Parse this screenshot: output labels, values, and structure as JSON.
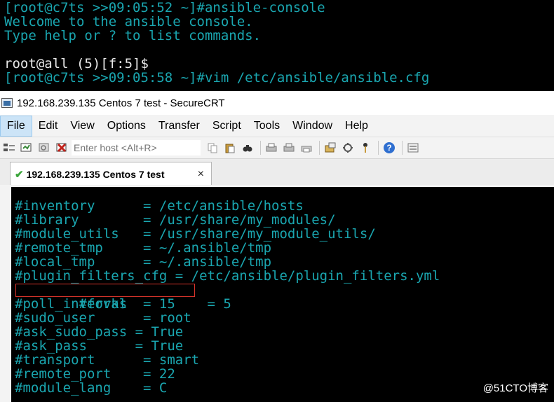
{
  "top_terminal": {
    "lines": [
      {
        "text": "[root@c7ts >>09:05:52 ~]#ansible-console",
        "color": "#1aa6b0"
      },
      {
        "text": "Welcome to the ansible console.",
        "color": "#1aa6b0"
      },
      {
        "text": "Type help or ? to list commands.",
        "color": "#1aa6b0"
      },
      {
        "text": "",
        "color": "#1aa6b0"
      },
      {
        "text": "root@all (5)[f:5]$",
        "color": "#e8e8e8"
      },
      {
        "text": "[root@c7ts >>09:05:58 ~]#vim /etc/ansible/ansible.cfg",
        "color": "#1aa6b0"
      }
    ]
  },
  "window": {
    "title": "192.168.239.135 Centos 7 test - SecureCRT"
  },
  "menu": [
    "File",
    "Edit",
    "View",
    "Options",
    "Transfer",
    "Script",
    "Tools",
    "Window",
    "Help"
  ],
  "toolbar": {
    "host_placeholder": "Enter host <Alt+R>"
  },
  "tab": {
    "label": "192.168.239.135 Centos 7 test",
    "close": "×"
  },
  "config_lines": [
    "#inventory      = /etc/ansible/hosts",
    "#library        = /usr/share/my_modules/",
    "#module_utils   = /usr/share/my_module_utils/",
    "#remote_tmp     = ~/.ansible/tmp",
    "#local_tmp      = ~/.ansible/tmp",
    "#plugin_filters_cfg = /etc/ansible/plugin_filters.yml",
    "#forks          = 5",
    "#poll_interval  = 15",
    "#sudo_user      = root",
    "#ask_sudo_pass = True",
    "#ask_pass      = True",
    "#transport      = smart",
    "#remote_port    = 22",
    "#module_lang    = C"
  ],
  "highlighted_line": "#forks          = 5",
  "watermark": "@51CTO博客",
  "colors": {
    "terminal_text": "#1aa6b0",
    "highlight_border": "#d9342b"
  }
}
